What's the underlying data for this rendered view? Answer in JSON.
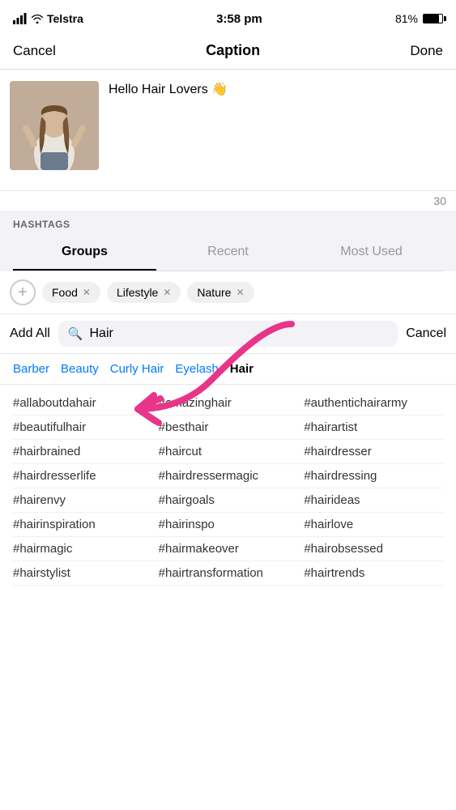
{
  "statusBar": {
    "carrier": "Telstra",
    "time": "3:58 pm",
    "battery": "81%"
  },
  "header": {
    "cancel": "Cancel",
    "title": "Caption",
    "done": "Done"
  },
  "caption": {
    "text": "Hello Hair Lovers 👋",
    "charCount": "30"
  },
  "hashtagsLabel": "HASHTAGS",
  "tabs": [
    {
      "label": "Groups",
      "active": true
    },
    {
      "label": "Recent",
      "active": false
    },
    {
      "label": "Most Used",
      "active": false
    }
  ],
  "chips": [
    {
      "label": "Food"
    },
    {
      "label": "Lifestyle"
    },
    {
      "label": "Nature"
    }
  ],
  "search": {
    "addAll": "Add All",
    "placeholder": "Hair",
    "cancel": "Cancel"
  },
  "groupLabels": [
    {
      "label": "Barber",
      "active": false
    },
    {
      "label": "Beauty",
      "active": false
    },
    {
      "label": "Curly Hair",
      "active": false
    },
    {
      "label": "Eyelash",
      "active": false
    },
    {
      "label": "Hair",
      "active": true
    }
  ],
  "hashtags": [
    [
      "#allaboutdahair",
      "#amazinghair",
      "#authentichai​rарmy"
    ],
    [
      "#beautifulhair",
      "#besthair",
      "#hairartist"
    ],
    [
      "#hairbrained",
      "#haircut",
      "#hairdresser"
    ],
    [
      "#hairdresserlife",
      "#hairdressermagic",
      "#hairdressing"
    ],
    [
      "#hairenvy",
      "#hairgoals",
      "#hairideas"
    ],
    [
      "#hairinspiration",
      "#hairinspo",
      "#hairlove"
    ],
    [
      "#hairmagic",
      "#hairmakeover",
      "#hairobsessed"
    ],
    [
      "#hairstylist",
      "#hairtransformation",
      "#hairtrends"
    ]
  ],
  "hashtagsFlat": [
    [
      "#allaboutdahair",
      "#amazinghair",
      "#authentichairarmy"
    ],
    [
      "#beautifulhair",
      "#besthair",
      "#hairartist"
    ],
    [
      "#hairbrained",
      "#haircut",
      "#hairdresser"
    ],
    [
      "#hairdresserlife",
      "#hairdressermagic",
      "#hairdressing"
    ],
    [
      "#hairenvy",
      "#hairgoals",
      "#hairideas"
    ],
    [
      "#hairinspiration",
      "#hairinspo",
      "#hairlove"
    ],
    [
      "#hairmagic",
      "#hairmakeover",
      "#hairobsessed"
    ],
    [
      "#hairstylist",
      "#hairtransformation",
      "#hairtrends"
    ]
  ]
}
